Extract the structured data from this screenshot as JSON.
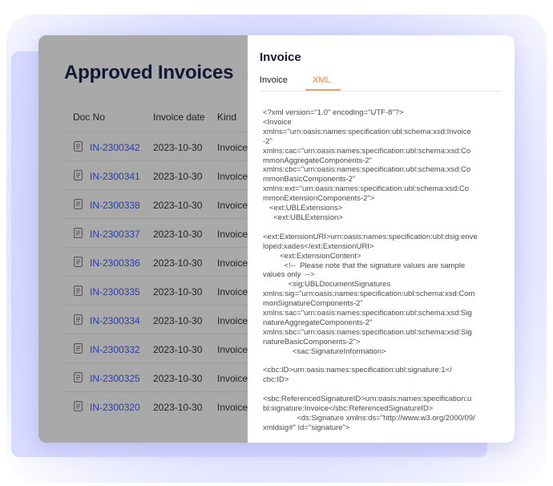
{
  "list": {
    "title": "Approved Invoices",
    "columns": {
      "doc_no": "Doc No",
      "invoice_date": "Invoice date",
      "kind": "Kind"
    },
    "rows": [
      {
        "doc_no": "IN-2300342",
        "date": "2023-10-30",
        "kind": "Invoice"
      },
      {
        "doc_no": "IN-2300341",
        "date": "2023-10-30",
        "kind": "Invoice"
      },
      {
        "doc_no": "IN-2300338",
        "date": "2023-10-30",
        "kind": "Invoice"
      },
      {
        "doc_no": "IN-2300337",
        "date": "2023-10-30",
        "kind": "Invoice"
      },
      {
        "doc_no": "IN-2300336",
        "date": "2023-10-30",
        "kind": "Invoice"
      },
      {
        "doc_no": "IN-2300335",
        "date": "2023-10-30",
        "kind": "Invoice"
      },
      {
        "doc_no": "IN-2300334",
        "date": "2023-10-30",
        "kind": "Invoice"
      },
      {
        "doc_no": "IN-2300332",
        "date": "2023-10-30",
        "kind": "Invoice"
      },
      {
        "doc_no": "IN-2300325",
        "date": "2023-10-30",
        "kind": "Invoice"
      },
      {
        "doc_no": "IN-2300320",
        "date": "2023-10-30",
        "kind": "Invoice"
      }
    ]
  },
  "detail": {
    "title": "Invoice",
    "tabs": [
      {
        "label": "Invoice"
      },
      {
        "label": "XML"
      }
    ],
    "active_tab": "XML",
    "xml_lines": [
      "<?xml version=\"1.0\" encoding=\"UTF-8\"?>",
      "<Invoice",
      "xmlns=\"urn:oasis:names:specification:ubl:schema:xsd:Invoice",
      "-2\"",
      "xmlns:cac=\"urn:oasis:names:specification:ubl:schema:xsd:Co",
      "mmonAggregateComponents-2\"",
      "xmlns:cbc=\"urn:oasis:names:specification:ubl:schema:xsd:Co",
      "mmonBasicComponents-2\"",
      "xmlns:ext=\"urn:oasis:names:specification:ubl:schema:xsd:Co",
      "mmonExtensionComponents-2\">",
      "   <ext:UBLExtensions>",
      "     <ext:UBLExtension>",
      "",
      "<ext:ExtensionURI>urn:oasis:names:specification:ubl:dsig:enve",
      "loped:xades</ext:ExtensionURI>",
      "        <ext:ExtensionContent>",
      "          <!--  Please note that the signature values are sample",
      "values only  -->",
      "            <sig:UBLDocumentSignatures",
      "xmlns:sig=\"urn:oasis:names:specification:ubl:schema:xsd:Com",
      "monSignatureComponents-2\"",
      "xmlns:sac=\"urn:oasis:names:specification:ubl:schema:xsd:Sig",
      "natureAggregateComponents-2\"",
      "xmlns:sbc=\"urn:oasis:names:specification:ubl:schema:xsd:Sig",
      "natureBasicComponents-2\">",
      "              <sac:SignatureInformation>",
      "",
      "<cbc:ID>urn:oasis:names:specification:ubl:signature:1</",
      "cbc:ID>",
      "",
      "<sbc:ReferencedSignatureID>urn:oasis:names:specification:u",
      "bl:signature:Invoice</sbc:ReferencedSignatureID>",
      "                <ds:Signature xmlns:ds=\"http://www.w3.org/2000/09/",
      "xmldsig#\" Id=\"signature\">"
    ]
  },
  "icons": {
    "row_icon": "document-icon"
  },
  "colors": {
    "accent": "#e8893a",
    "link": "#2c3da3",
    "overlay": "#a9a9a9",
    "glow": "#cdd0ff"
  }
}
